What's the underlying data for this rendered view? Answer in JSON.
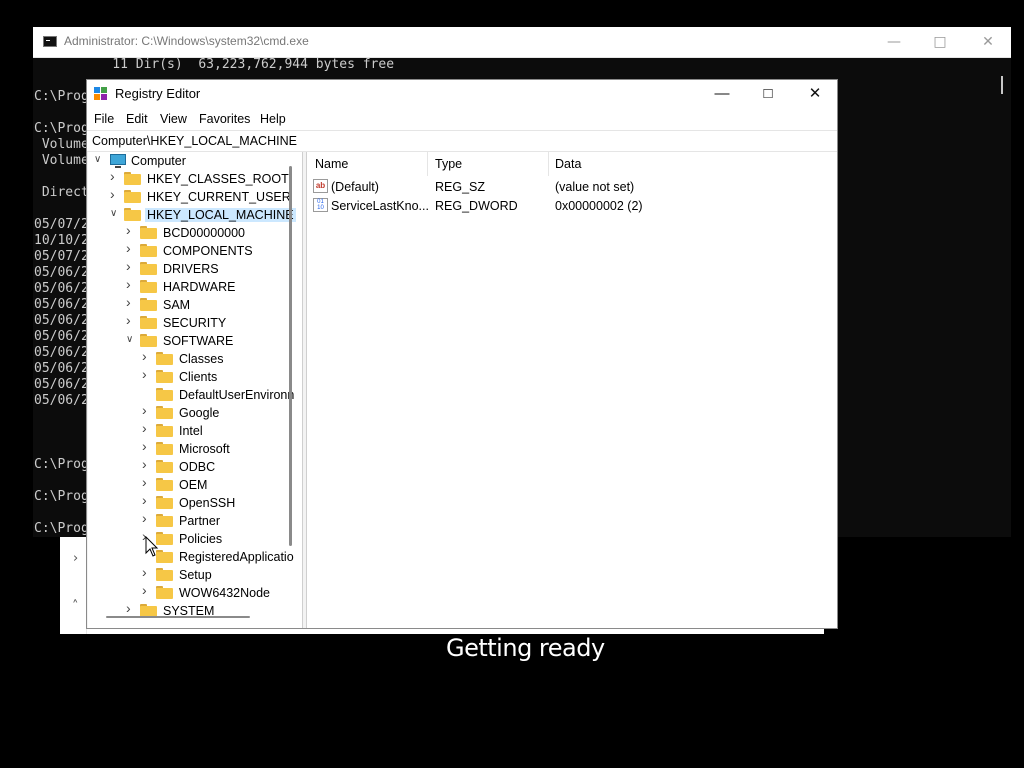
{
  "cmd": {
    "title": "Administrator: C:\\Windows\\system32\\cmd.exe",
    "lines": [
      "          11 Dir(s)  63,223,762,944 bytes free",
      "",
      "C:\\Prog",
      "",
      "C:\\Prog",
      " Volume",
      " Volume",
      "",
      " Direct",
      "",
      "05/07/2",
      "10/10/2",
      "05/07/2",
      "05/06/2",
      "05/06/2",
      "05/06/2",
      "05/06/2",
      "05/06/2",
      "05/06/2",
      "05/06/2",
      "05/06/2",
      "05/06/2",
      "",
      "",
      "",
      "C:\\Prog",
      "",
      "C:\\Prog",
      "",
      "C:\\Prog"
    ]
  },
  "getting_ready": "Getting ready",
  "regedit": {
    "title": "Registry Editor",
    "menu": [
      "File",
      "Edit",
      "View",
      "Favorites",
      "Help"
    ],
    "address": "Computer\\HKEY_LOCAL_MACHINE",
    "tree": [
      {
        "label": "Computer",
        "level": 0,
        "expander": "open",
        "icon": "computer"
      },
      {
        "label": "HKEY_CLASSES_ROOT",
        "level": 1,
        "expander": "closed"
      },
      {
        "label": "HKEY_CURRENT_USER",
        "level": 1,
        "expander": "closed"
      },
      {
        "label": "HKEY_LOCAL_MACHINE",
        "level": 1,
        "expander": "open",
        "selected": true
      },
      {
        "label": "BCD00000000",
        "level": 2,
        "expander": "closed"
      },
      {
        "label": "COMPONENTS",
        "level": 2,
        "expander": "closed"
      },
      {
        "label": "DRIVERS",
        "level": 2,
        "expander": "closed"
      },
      {
        "label": "HARDWARE",
        "level": 2,
        "expander": "closed"
      },
      {
        "label": "SAM",
        "level": 2,
        "expander": "closed"
      },
      {
        "label": "SECURITY",
        "level": 2,
        "expander": "closed"
      },
      {
        "label": "SOFTWARE",
        "level": 2,
        "expander": "open"
      },
      {
        "label": "Classes",
        "level": 3,
        "expander": "closed"
      },
      {
        "label": "Clients",
        "level": 3,
        "expander": "closed"
      },
      {
        "label": "DefaultUserEnvironn",
        "level": 3,
        "expander": "none"
      },
      {
        "label": "Google",
        "level": 3,
        "expander": "closed"
      },
      {
        "label": "Intel",
        "level": 3,
        "expander": "closed"
      },
      {
        "label": "Microsoft",
        "level": 3,
        "expander": "closed"
      },
      {
        "label": "ODBC",
        "level": 3,
        "expander": "closed"
      },
      {
        "label": "OEM",
        "level": 3,
        "expander": "closed"
      },
      {
        "label": "OpenSSH",
        "level": 3,
        "expander": "closed"
      },
      {
        "label": "Partner",
        "level": 3,
        "expander": "closed"
      },
      {
        "label": "Policies",
        "level": 3,
        "expander": "closed"
      },
      {
        "label": "RegisteredApplicatio",
        "level": 3,
        "expander": "none"
      },
      {
        "label": "Setup",
        "level": 3,
        "expander": "closed"
      },
      {
        "label": "WOW6432Node",
        "level": 3,
        "expander": "closed"
      },
      {
        "label": "SYSTEM",
        "level": 2,
        "expander": "closed"
      }
    ],
    "columns": [
      "Name",
      "Type",
      "Data"
    ],
    "values": [
      {
        "name": "(Default)",
        "type": "REG_SZ",
        "data": "(value not set)",
        "icon": "string-value-icon"
      },
      {
        "name": "ServiceLastKno...",
        "type": "REG_DWORD",
        "data": "0x00000002 (2)",
        "icon": "binary-value-icon"
      }
    ]
  },
  "colors": {
    "folder": "#f6c746",
    "selection": "#cce8ff",
    "console_bg": "#0c0c0c",
    "console_text": "#cccccc"
  }
}
